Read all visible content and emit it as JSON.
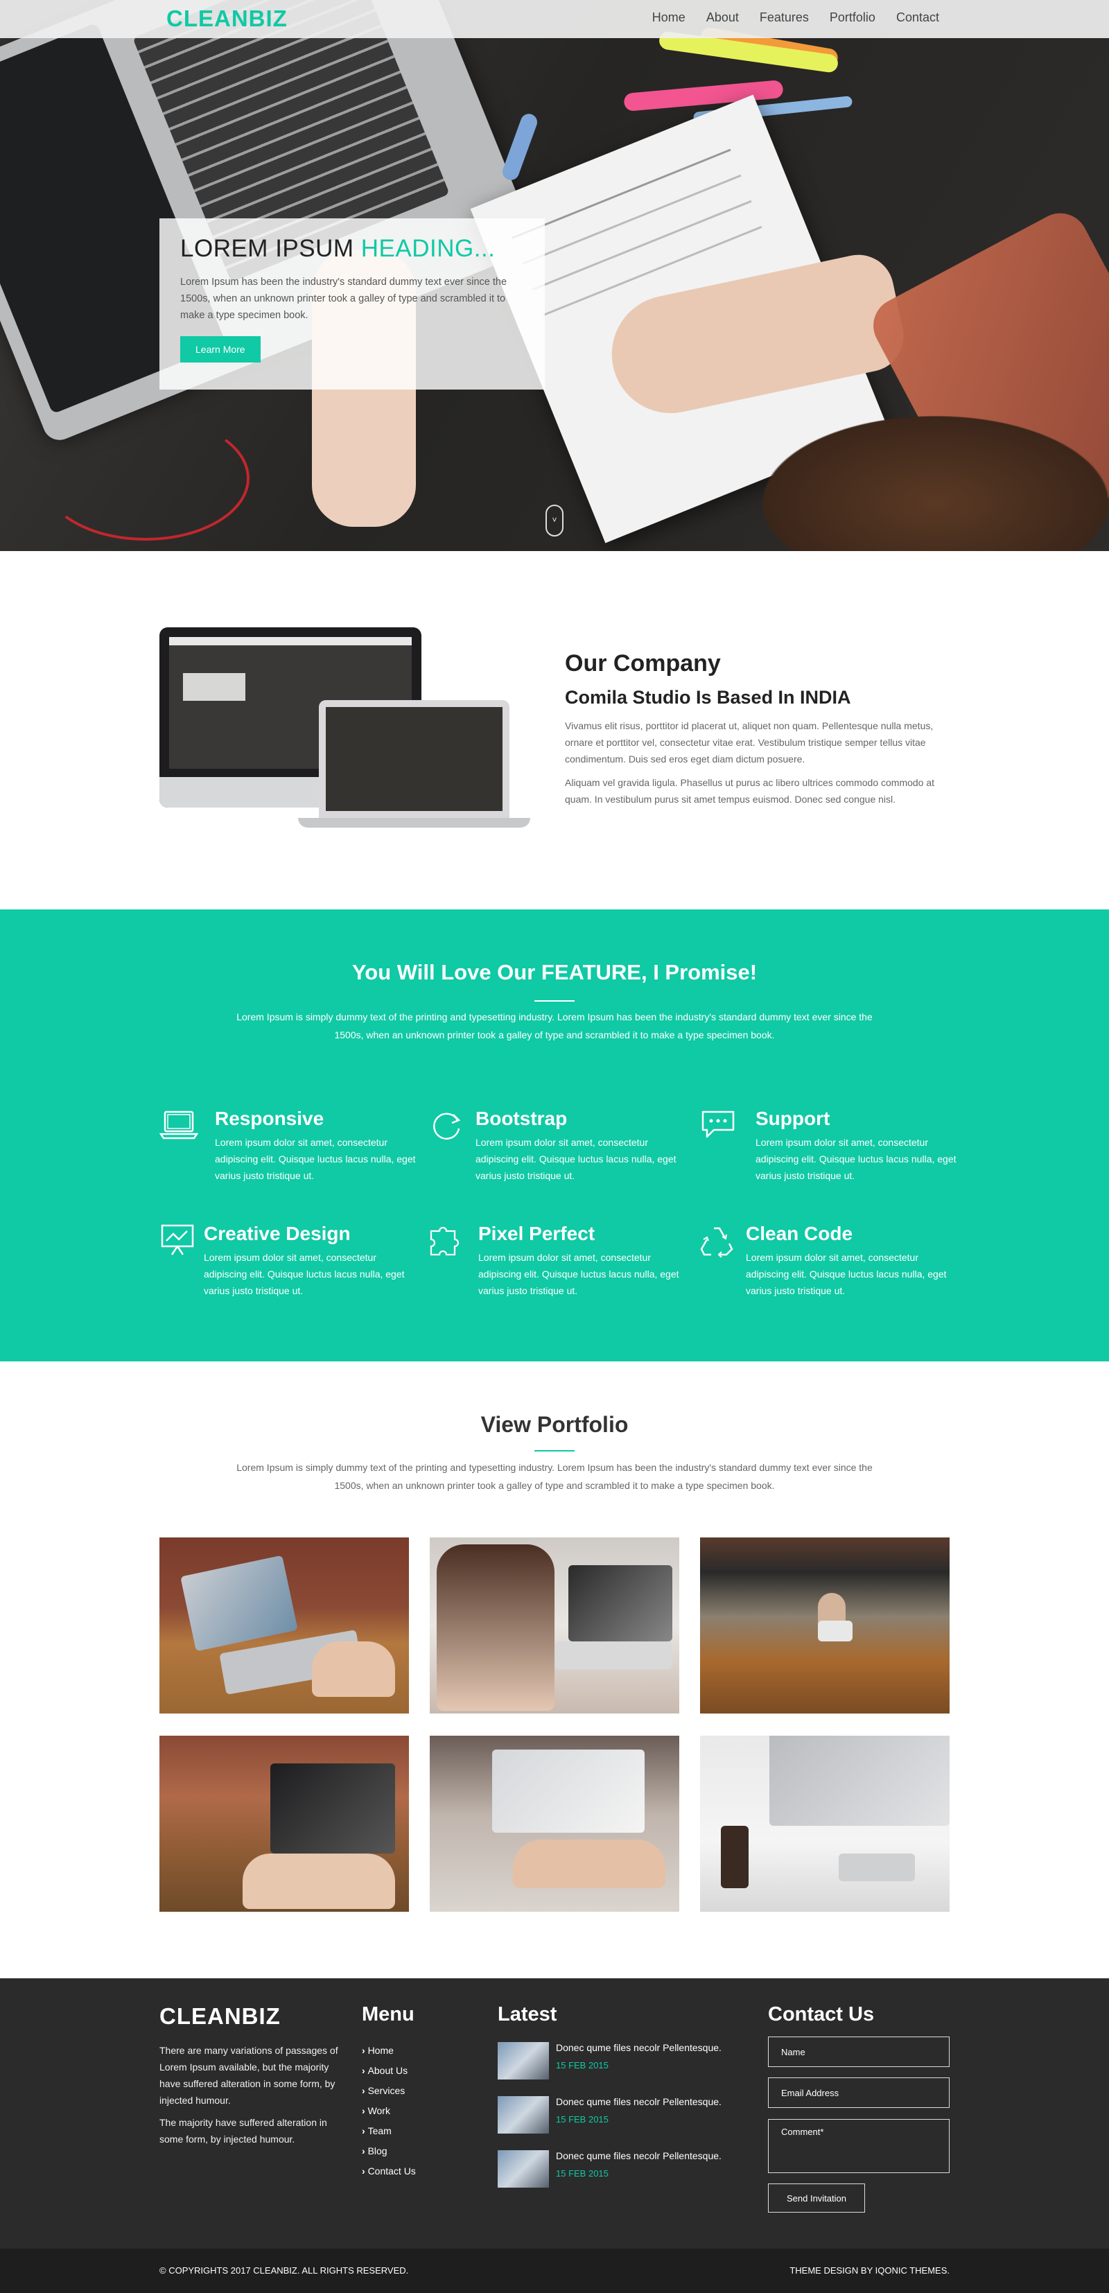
{
  "nav": {
    "logo": "CLEANBIZ",
    "items": [
      "Home",
      "About",
      "Features",
      "Portfolio",
      "Contact"
    ]
  },
  "hero": {
    "title_main": "LOREM IPSUM ",
    "title_accent": "HEADING...",
    "text": "Lorem Ipsum has been the industry's standard dummy text ever since the 1500s, when an unknown printer took a galley of type and scrambled it to make a type specimen book.",
    "button": "Learn More",
    "scroll_glyph": "˅"
  },
  "company": {
    "title": "Our Company",
    "subtitle": "Comila Studio Is Based In INDIA",
    "p1": "Vivamus elit risus, porttitor id placerat ut, aliquet non quam. Pellentesque nulla metus, ornare et porttitor vel, consectetur vitae erat. Vestibulum tristique semper tellus vitae condimentum. Duis sed eros eget diam dictum posuere.",
    "p2": "Aliquam vel gravida ligula. Phasellus ut purus ac libero ultrices commodo commodo at quam. In vestibulum purus sit amet tempus euismod. Donec sed congue nisl."
  },
  "features": {
    "title": "You Will Love Our FEATURE, I Promise!",
    "intro": "Lorem Ipsum is simply dummy text of the printing and typesetting industry. Lorem Ipsum has been the industry's standard dummy text ever since the 1500s, when an unknown printer took a galley of type and scrambled it to make a type specimen book.",
    "items": [
      {
        "name": "Responsive",
        "icon": "laptop-icon",
        "desc": "Lorem ipsum dolor sit amet, consectetur adipiscing elit. Quisque luctus lacus nulla, eget varius justo tristique ut."
      },
      {
        "name": "Bootstrap",
        "icon": "refresh-icon",
        "desc": "Lorem ipsum dolor sit amet, consectetur adipiscing elit. Quisque luctus lacus nulla, eget varius justo tristique ut."
      },
      {
        "name": "Support",
        "icon": "chat-icon",
        "desc": "Lorem ipsum dolor sit amet, consectetur adipiscing elit. Quisque luctus lacus nulla, eget varius justo tristique ut."
      },
      {
        "name": "Creative Design",
        "icon": "presentation-icon",
        "desc": "Lorem ipsum dolor sit amet, consectetur adipiscing elit. Quisque luctus lacus nulla, eget varius justo tristique ut."
      },
      {
        "name": "Pixel Perfect",
        "icon": "puzzle-icon",
        "desc": "Lorem ipsum dolor sit amet, consectetur adipiscing elit. Quisque luctus lacus nulla, eget varius justo tristique ut."
      },
      {
        "name": "Clean Code",
        "icon": "recycle-icon",
        "desc": "Lorem ipsum dolor sit amet, consectetur adipiscing elit. Quisque luctus lacus nulla, eget varius justo tristique ut."
      }
    ]
  },
  "portfolio": {
    "title": "View Portfolio",
    "intro": "Lorem Ipsum is simply dummy text of the printing and typesetting industry. Lorem Ipsum has been the industry's standard dummy text ever since the 1500s, when an unknown printer took a galley of type and scrambled it to make a type specimen book."
  },
  "footer": {
    "brand": "CLEANBIZ",
    "about1": "There are many variations of passages of Lorem Ipsum available, but the majority have suffered alteration in some form, by injected humour.",
    "about2": "The majority have suffered alteration in some form, by injected humour.",
    "menu_title": "Menu",
    "menu": [
      "Home",
      "About Us",
      "Services",
      "Work",
      "Team",
      "Blog",
      "Contact Us"
    ],
    "latest_title": "Latest",
    "posts": [
      {
        "title": "Donec qume files necolr Pellentesque.",
        "date": "15 FEB 2015"
      },
      {
        "title": "Donec qume files necolr Pellentesque.",
        "date": "15 FEB 2015"
      },
      {
        "title": "Donec qume files necolr Pellentesque.",
        "date": "15 FEB 2015"
      }
    ],
    "contact_title": "Contact Us",
    "name_placeholder": "Name",
    "email_placeholder": "Email Address",
    "comment_placeholder": "Comment*",
    "send": "Send Invitation"
  },
  "bottom": {
    "copyright": "© COPYRIGHTS 2017 CLEANBIZ. ALL RIGHTS RESERVED.",
    "credit": "THEME DESIGN BY IQONIC THEMES."
  },
  "colors": {
    "accent": "#10c9a5",
    "footer": "#2b2b2b",
    "bottom_bar": "#1e1e1e"
  }
}
